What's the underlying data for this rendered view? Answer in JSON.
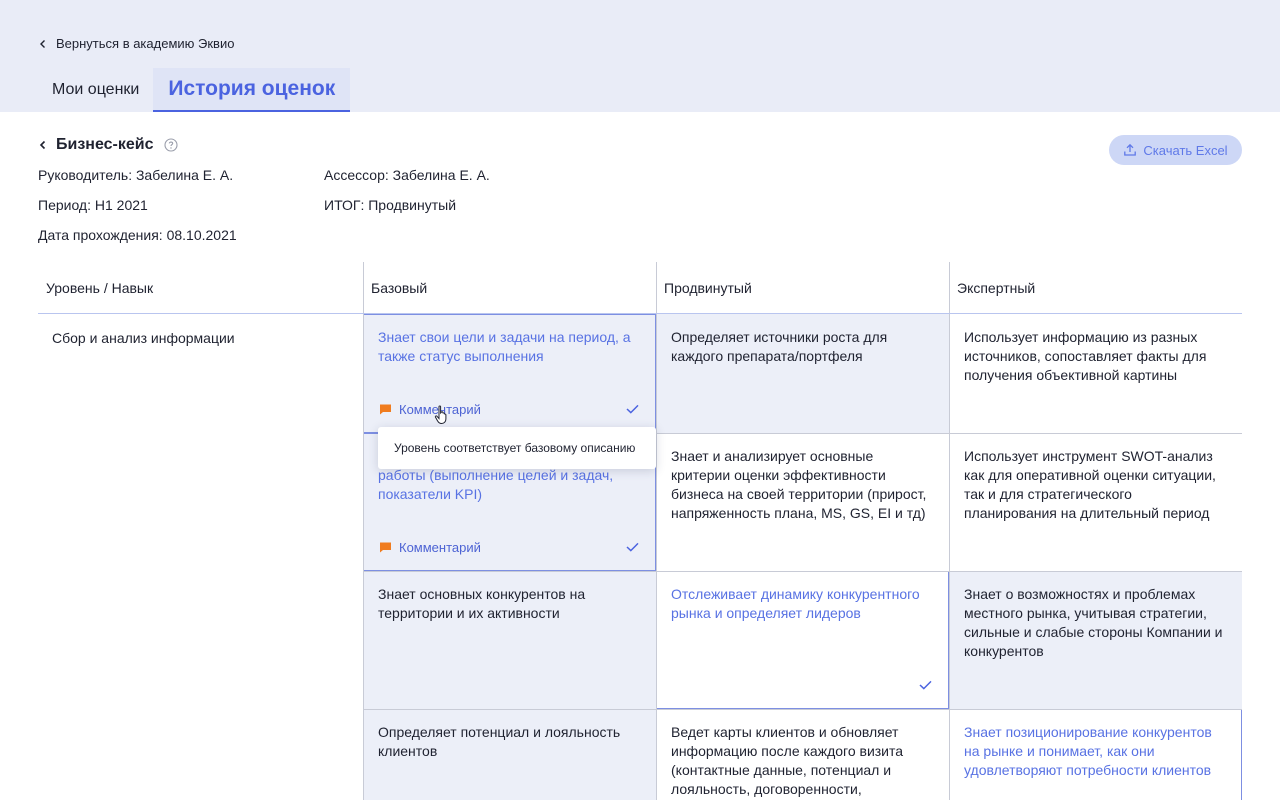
{
  "nav": {
    "back_label": "Вернуться в академию Эквио"
  },
  "tabs": [
    {
      "label": "Мои оценки"
    },
    {
      "label": "История оценок"
    }
  ],
  "case": {
    "title": "Бизнес-кейс",
    "manager": "Руководитель: Забелина Е. А.",
    "assessor": "Ассессор: Забелина Е. А.",
    "period": "Период: H1 2021",
    "result": "ИТОГ: Продвинутый",
    "date": "Дата прохождения: 08.10.2021"
  },
  "actions": {
    "excel_label": "Скачать Excel"
  },
  "table": {
    "headers": [
      "Уровень / Навык",
      "Базовый",
      "Продвинутый",
      "Экспертный"
    ],
    "skill": "Сбор и анализ информации",
    "rows": [
      [
        "Знает свои цели и задачи на период, а также статус выполнения",
        "Определяет источники роста для каждого препарата/портфеля",
        "Использует информацию из разных источников, сопоставляет факты для получения объективной картины"
      ],
      [
        "работы (выполнение целей и задач, показатели KPI)",
        "Знает и анализирует основные критерии оценки эффективности бизнеса на своей территории (прирост, напряженность плана, MS, GS, EI и тд)",
        "Использует инструмент SWOT-анализ как для оперативной оценки ситуации, так и для стратегического планирования на длительный период"
      ],
      [
        "Знает основных конкурентов на территории и их активности",
        "Отслеживает динамику конкурентного рынка и определяет лидеров",
        "Знает о возможностях и проблемах местного рынка, учитывая стратегии, сильные и слабые стороны Компании и конкурентов"
      ],
      [
        "Определяет потенциал и лояльность клиентов",
        "Ведет карты клиентов и обновляет информацию после каждого визита (контактные данные, потенциал и лояльность, договоренности,",
        "Знает позиционирование конкурентов на рынке и понимает, как они удовлетворяют потребности клиентов"
      ]
    ],
    "comment_label": "Комментарий",
    "tooltip": "Уровень соответствует базовому описанию"
  },
  "colors": {
    "accent": "#4b63e0",
    "selected_text": "#5872e3",
    "shade": "#eceff8",
    "comment_flag": "#f07c1f"
  }
}
